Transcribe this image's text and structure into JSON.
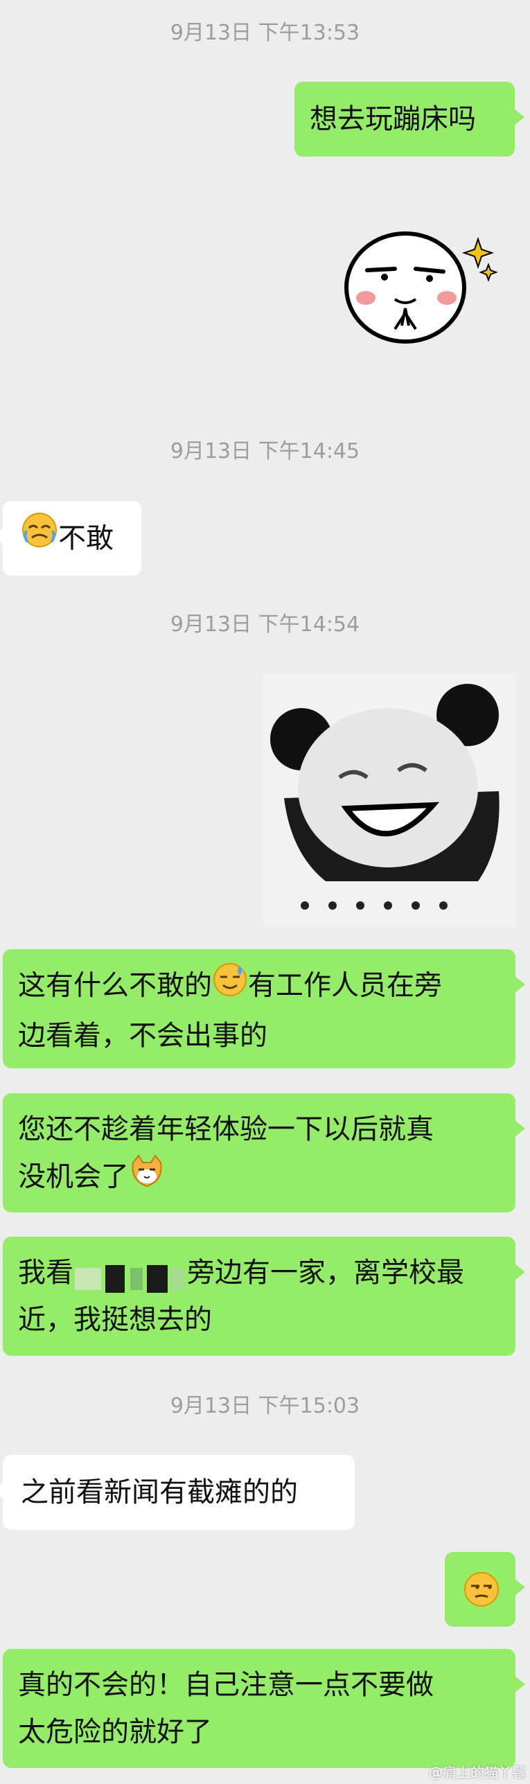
{
  "timestamps": [
    "9月13日 下午13:53",
    "9月13日 下午14:45",
    "9月13日 下午14:54",
    "9月13日 下午15:03"
  ],
  "messages": {
    "m1": "想去玩蹦床吗",
    "m2": "不敢",
    "m3a": "这有什么不敢的",
    "m3b": "有工作人员在旁",
    "m3c": "边看着，不会出事的",
    "m4a": "您还不趁着年轻体验一下以后就真",
    "m4b": "没机会了",
    "m5a": "我看",
    "m5b": "旁边有一家，离学校最",
    "m5c": "近，我挺想去的",
    "m6": "之前看新闻有截瘫的的",
    "m8a": "真的不会的！自己注意一点不要做",
    "m8b": "太危险的就好了"
  },
  "stickers": {
    "s1_name": "smirk-bun-sticker",
    "s2_name": "panda-laugh-sticker"
  },
  "emoji": {
    "crying": "crying-face-emoji",
    "sweat": "sweat-smile-emoji",
    "cat": "cat-face-emoji",
    "unamused": "unamused-face-emoji"
  },
  "colors": {
    "background": "#ededed",
    "bubble_sent": "#95ec69",
    "bubble_received": "#ffffff",
    "timestamp": "#9d9d9d"
  },
  "watermark": "@肩上的猫丫鬟"
}
